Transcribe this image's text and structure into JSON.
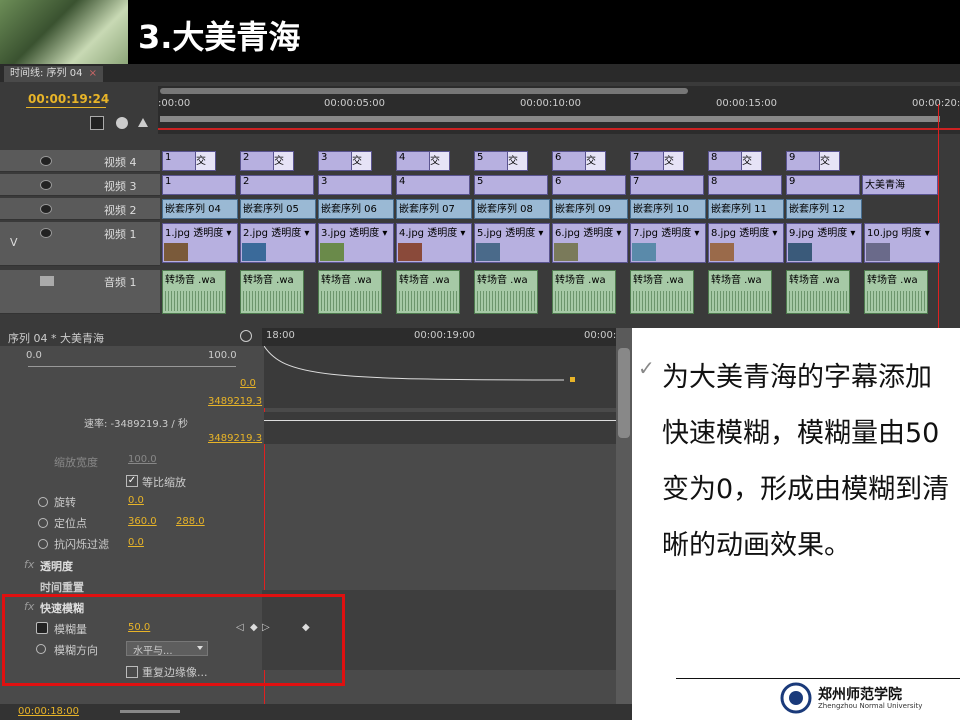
{
  "slide": {
    "title": "3.大美青海"
  },
  "timeline": {
    "tab_label": "时间线: 序列 04",
    "tab_close": "×",
    "timecode": "00:00:19:24",
    "ruler_labels": [
      ":00:00",
      "00:00:05:00",
      "00:00:10:00",
      "00:00:15:00",
      "00:00:20:0"
    ],
    "tracks": {
      "v4": "视频 4",
      "v3": "视频 3",
      "v2": "视频 2",
      "v1": "视频 1",
      "a1": "音频 1",
      "v_marker": "V",
      "a_marker": "A1"
    },
    "v4_clips": [
      "1",
      "2",
      "3",
      "4",
      "5",
      "6",
      "7",
      "8",
      "9"
    ],
    "v4_sub": "交",
    "v3_clips": [
      "1",
      "2",
      "3",
      "4",
      "5",
      "6",
      "7",
      "8",
      "9"
    ],
    "v3_title_clip": "大美青海",
    "v2_clips": [
      "嵌套序列 04",
      "嵌套序列 05",
      "嵌套序列 06",
      "嵌套序列 07",
      "嵌套序列 08",
      "嵌套序列 09",
      "嵌套序列 10",
      "嵌套序列 11",
      "嵌套序列 12"
    ],
    "v1_clips": [
      "1.jpg 透明度 ▾",
      "2.jpg 透明度 ▾",
      "3.jpg 透明度 ▾",
      "4.jpg 透明度 ▾",
      "5.jpg 透明度 ▾",
      "6.jpg 透明度 ▾",
      "7.jpg 透明度 ▾",
      "8.jpg 透明度 ▾",
      "9.jpg 透明度 ▾",
      "10.jpg 明度 ▾"
    ],
    "a1_clips": [
      "转场音 .wa",
      "转场音 .wa",
      "转场音 .wa",
      "转场音 .wa",
      "转场音 .wa",
      "转场音 .wa",
      "转场音 .wa",
      "转场音 .wa",
      "转场音 .wa",
      "转场音 .wa"
    ]
  },
  "effects": {
    "header": "序列 04 * 大美青海",
    "ruler_labels": [
      "18:00",
      "00:00:19:00",
      "00:00:"
    ],
    "slider_min": "0.0",
    "slider_max": "100.0",
    "value_0": "0.0",
    "value_big1": "3489219.3",
    "rate_label": "速率: -3489219.3 / 秒",
    "value_big2": "3489219.3",
    "scale_width_label": "缩放宽度",
    "scale_width_val": "100.0",
    "uniform_scale_label": "等比缩放",
    "rotation_label": "旋转",
    "rotation_val": "0.0",
    "anchor_label": "定位点",
    "anchor_x": "360.0",
    "anchor_y": "288.0",
    "antiflicker_label": "抗闪烁过滤",
    "antiflicker_val": "0.0",
    "opacity_label": "透明度",
    "time_remap_label": "时间重置",
    "fast_blur_label": "快速模糊",
    "blur_amount_label": "模糊量",
    "blur_amount_val": "50.0",
    "blur_dir_label": "模糊方向",
    "blur_dir_val": "水平与...",
    "repeat_edge_label": "重复边缘像...",
    "footer_tc": "00:00:18:00",
    "accent": "#e8b428",
    "highlight": "#e01010"
  },
  "bullet": {
    "text": "为大美青海的字幕添加快速模糊，模糊量由50变为0，形成由模糊到清晰的动画效果。"
  },
  "university": {
    "name": "郑州师范学院",
    "sub": "Zhengzhou Normal University"
  }
}
